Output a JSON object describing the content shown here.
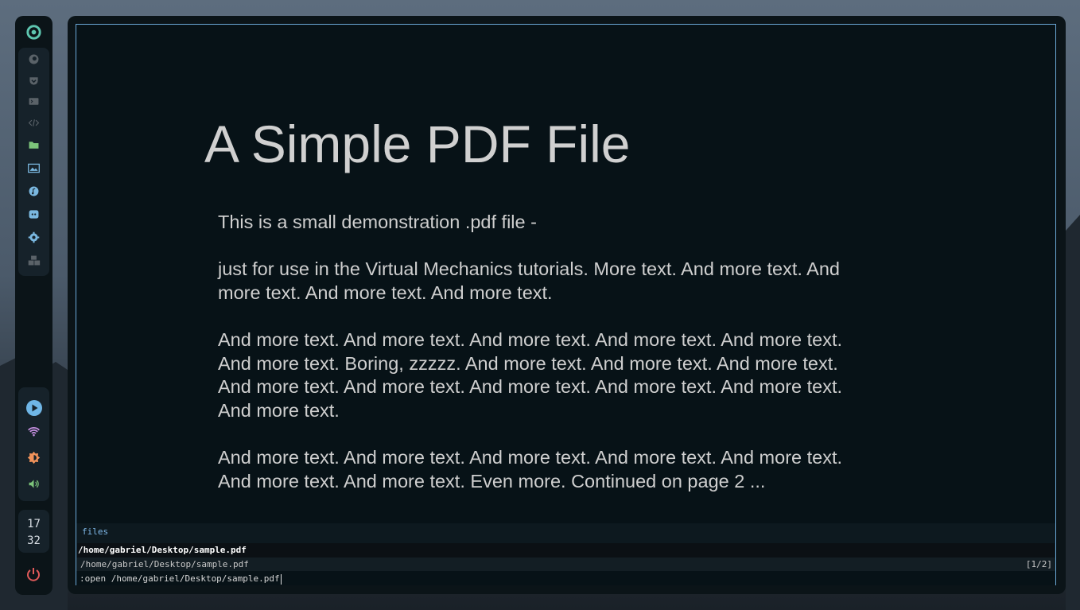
{
  "sidebar": {
    "icons": [
      "app-logo-icon",
      "firefox-icon",
      "pocket-icon",
      "terminal-icon",
      "code-icon",
      "folder-icon",
      "image-icon",
      "music-icon",
      "discord-icon",
      "settings-icon",
      "packages-icon"
    ],
    "status_icons": [
      "play-icon",
      "wifi-icon",
      "brightness-icon",
      "volume-icon"
    ],
    "clock": {
      "hour": "17",
      "minute": "32"
    },
    "power_icon": "power-icon"
  },
  "document": {
    "title": "A Simple PDF File",
    "paragraphs": [
      "This is a small demonstration .pdf file -",
      "just for use in the Virtual Mechanics tutorials. More text. And more text. And more text. And more text. And more text.",
      "And more text. And more text. And more text. And more text. And more text. And more text. Boring, zzzzz. And more text. And more text. And more text. And more text. And more text. And more text. And more text. And more text. And more text.",
      "And more text. And more text. And more text. And more text. And more text. And more text. And more text. Even more. Continued on page 2 ..."
    ]
  },
  "completion": {
    "category": "files",
    "selected_item": "/home/gabriel/Desktop/sample.pdf"
  },
  "statusbar": {
    "url": "/home/gabriel/Desktop/sample.pdf",
    "page_indicator": "[1/2]"
  },
  "command": {
    "text": ":open /home/gabriel/Desktop/sample.pdf"
  },
  "colors": {
    "accent_border": "#6aa8d6",
    "completion_header": "#7fb8e8",
    "power": "#e05a5a"
  }
}
